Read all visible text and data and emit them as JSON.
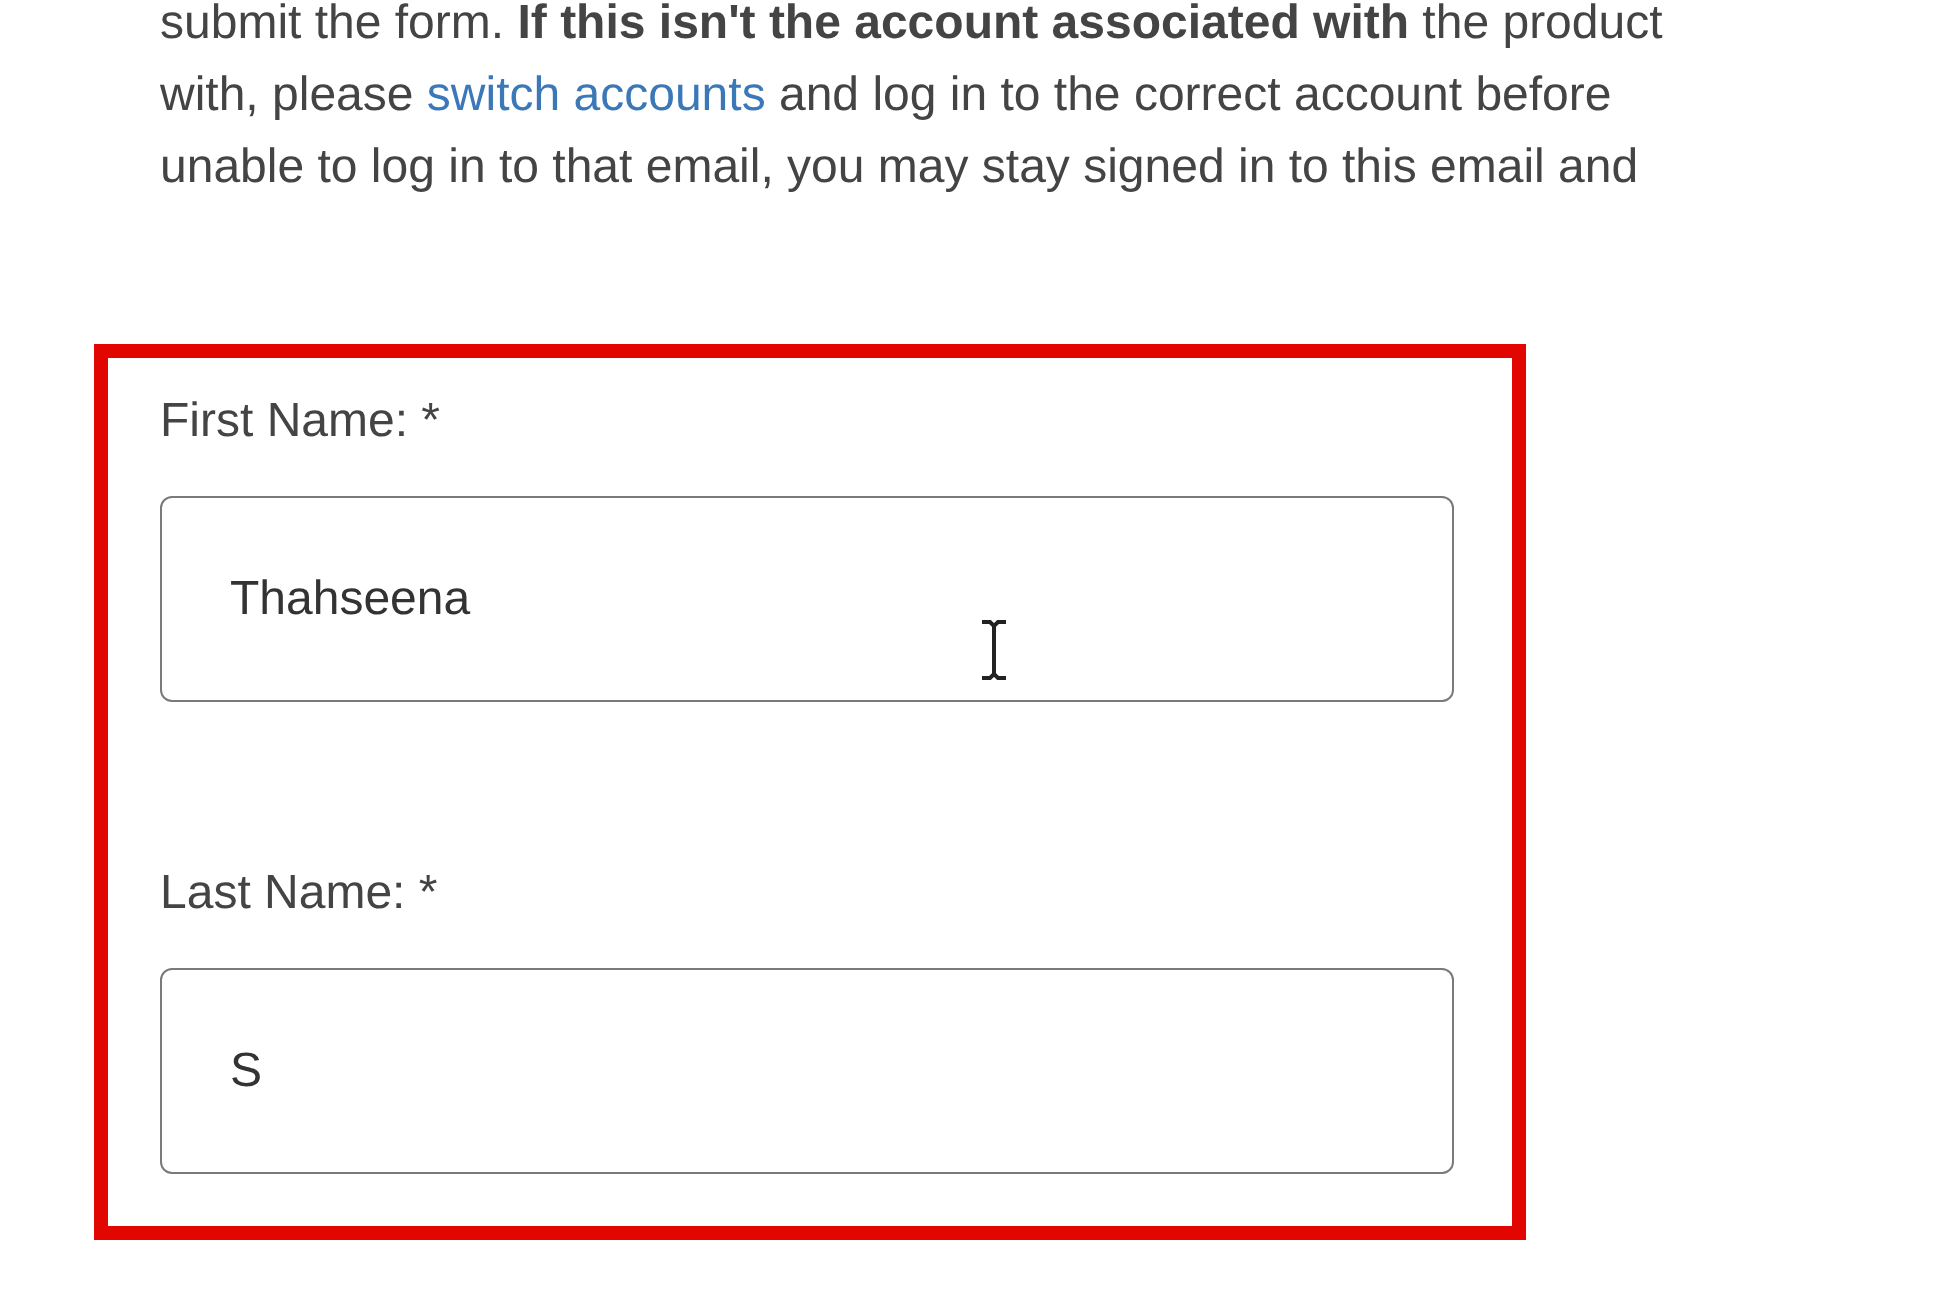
{
  "intro_lines": [
    [
      {
        "kind": "text",
        "text": "submit the form. **If this isn't the account associated with** the product"
      }
    ],
    [
      {
        "kind": "text",
        "text": "with, please "
      },
      {
        "kind": "link",
        "text": "switch accounts"
      },
      {
        "kind": "text",
        "text": " and log in to the correct account before"
      }
    ],
    [
      {
        "kind": "text",
        "text": "unable to log in to that email, you may stay signed in to this email and"
      }
    ]
  ],
  "form": {
    "highlighted": true,
    "fields": [
      {
        "label": "First Name: *",
        "value": "Thahseena",
        "cursor": true
      },
      {
        "label": "Last Name: *",
        "value": "S",
        "cursor": false
      }
    ]
  }
}
